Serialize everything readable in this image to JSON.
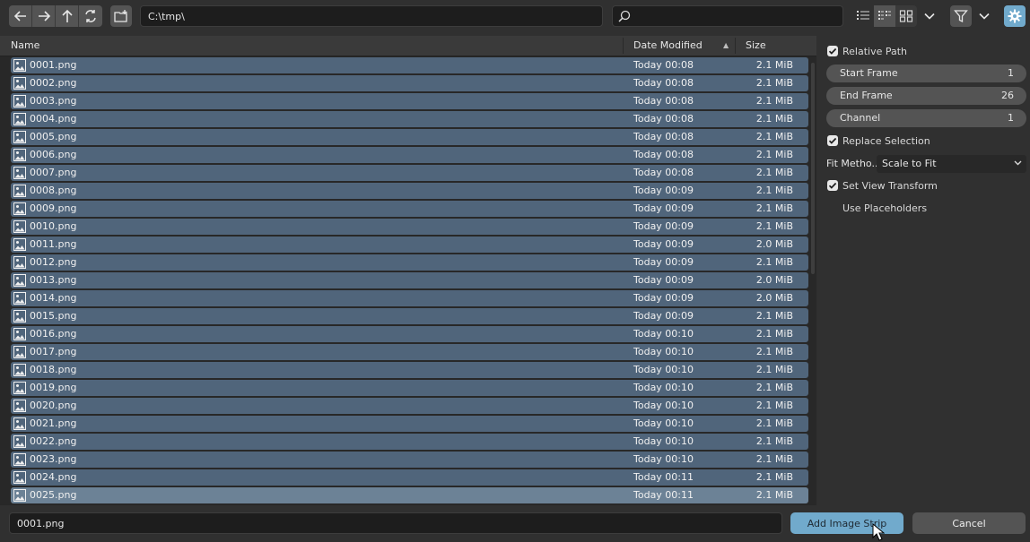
{
  "toolbar": {
    "path": "C:\\tmp\\",
    "search_placeholder": "",
    "nav_icons": [
      "back-arrow-icon",
      "forward-arrow-icon",
      "parent-dir-icon",
      "refresh-icon"
    ],
    "new_folder_icon": "new-folder-icon",
    "display_modes": [
      "vertical-list-icon",
      "horizontal-list-icon",
      "thumbnails-icon"
    ],
    "filter_icon": "filter-icon",
    "settings_icon": "gear-icon"
  },
  "columns": {
    "name": "Name",
    "date": "Date Modified",
    "size": "Size",
    "sort_indicator": "▲"
  },
  "files": [
    {
      "name": "0001.png",
      "date": "Today 00:08",
      "size": "2.1 MiB"
    },
    {
      "name": "0002.png",
      "date": "Today 00:08",
      "size": "2.1 MiB"
    },
    {
      "name": "0003.png",
      "date": "Today 00:08",
      "size": "2.1 MiB"
    },
    {
      "name": "0004.png",
      "date": "Today 00:08",
      "size": "2.1 MiB"
    },
    {
      "name": "0005.png",
      "date": "Today 00:08",
      "size": "2.1 MiB"
    },
    {
      "name": "0006.png",
      "date": "Today 00:08",
      "size": "2.1 MiB"
    },
    {
      "name": "0007.png",
      "date": "Today 00:08",
      "size": "2.1 MiB"
    },
    {
      "name": "0008.png",
      "date": "Today 00:09",
      "size": "2.1 MiB"
    },
    {
      "name": "0009.png",
      "date": "Today 00:09",
      "size": "2.1 MiB"
    },
    {
      "name": "0010.png",
      "date": "Today 00:09",
      "size": "2.1 MiB"
    },
    {
      "name": "0011.png",
      "date": "Today 00:09",
      "size": "2.0 MiB"
    },
    {
      "name": "0012.png",
      "date": "Today 00:09",
      "size": "2.1 MiB"
    },
    {
      "name": "0013.png",
      "date": "Today 00:09",
      "size": "2.0 MiB"
    },
    {
      "name": "0014.png",
      "date": "Today 00:09",
      "size": "2.0 MiB"
    },
    {
      "name": "0015.png",
      "date": "Today 00:09",
      "size": "2.1 MiB"
    },
    {
      "name": "0016.png",
      "date": "Today 00:10",
      "size": "2.1 MiB"
    },
    {
      "name": "0017.png",
      "date": "Today 00:10",
      "size": "2.1 MiB"
    },
    {
      "name": "0018.png",
      "date": "Today 00:10",
      "size": "2.1 MiB"
    },
    {
      "name": "0019.png",
      "date": "Today 00:10",
      "size": "2.1 MiB"
    },
    {
      "name": "0020.png",
      "date": "Today 00:10",
      "size": "2.1 MiB"
    },
    {
      "name": "0021.png",
      "date": "Today 00:10",
      "size": "2.1 MiB"
    },
    {
      "name": "0022.png",
      "date": "Today 00:10",
      "size": "2.1 MiB"
    },
    {
      "name": "0023.png",
      "date": "Today 00:10",
      "size": "2.1 MiB"
    },
    {
      "name": "0024.png",
      "date": "Today 00:11",
      "size": "2.1 MiB"
    },
    {
      "name": "0025.png",
      "date": "Today 00:11",
      "size": "2.1 MiB"
    }
  ],
  "options": {
    "relative_path": {
      "label": "Relative Path",
      "checked": true
    },
    "start_frame": {
      "label": "Start Frame",
      "value": "1"
    },
    "end_frame": {
      "label": "End Frame",
      "value": "26"
    },
    "channel": {
      "label": "Channel",
      "value": "1"
    },
    "replace_selection": {
      "label": "Replace Selection",
      "checked": true
    },
    "fit_method": {
      "label": "Fit Metho...",
      "value": "Scale to Fit"
    },
    "set_view_transform": {
      "label": "Set View Transform",
      "checked": true
    },
    "use_placeholders": {
      "label": "Use Placeholders",
      "checked": false
    }
  },
  "bottom": {
    "filename": "0001.png",
    "confirm_label": "Add Image Strip",
    "cancel_label": "Cancel"
  },
  "colors": {
    "row_selected": "#50657b",
    "row_active": "#6c8296",
    "primary_button": "#71aacc",
    "accent_settings": "#71aacc"
  }
}
